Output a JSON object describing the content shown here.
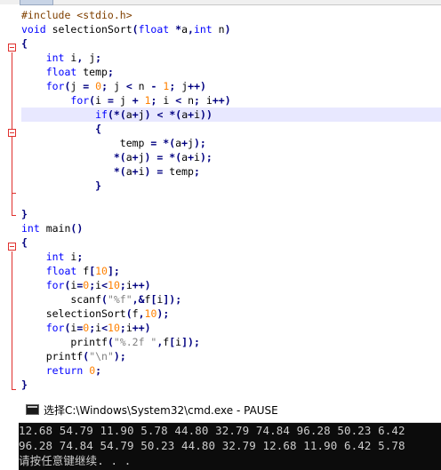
{
  "code_lines": [
    "#include <stdio.h>",
    "void selectionSort(float *a,int n)",
    "{",
    "    int i, j;",
    "    float temp;",
    "    for(j = 0; j < n - 1; j++)",
    "        for(i = j + 1; i < n; i++)",
    "            if(*(a+j) < *(a+i))",
    "            {",
    "                temp = *(a+j);",
    "               *(a+j) = *(a+i);",
    "               *(a+i) = temp;",
    "            }",
    "",
    "}",
    "int main()",
    "{",
    "    int i;",
    "    float f[10];",
    "    for(i=0;i<10;i++)",
    "        scanf(\"%f\",&f[i]);",
    "    selectionSort(f,10);",
    "    for(i=0;i<10;i++)",
    "        printf(\"%.2f \",f[i]);",
    "    printf(\"\\n\");",
    "    return 0;",
    "}"
  ],
  "console": {
    "title": "选择C:\\Windows\\System32\\cmd.exe - PAUSE",
    "lines": [
      "12.68 54.79 11.90 5.78 44.80 32.79 74.84 96.28 50.23 6.42",
      "96.28 74.84 54.79 50.23 44.80 32.79 12.68 11.90 6.42 5.78",
      "请按任意键继续. . ."
    ]
  },
  "colors": {
    "keyword": "#0000ff",
    "preprocessor": "#804000",
    "number": "#ff8000",
    "string": "#808080",
    "operator": "#000080",
    "current_line_bg": "#e8e8ff",
    "fold_marker": "#e0302d",
    "console_bg": "#0c0c0c",
    "console_text": "#cccccc"
  },
  "icons": [
    "cmd-icon",
    "fold-collapse-icon"
  ]
}
